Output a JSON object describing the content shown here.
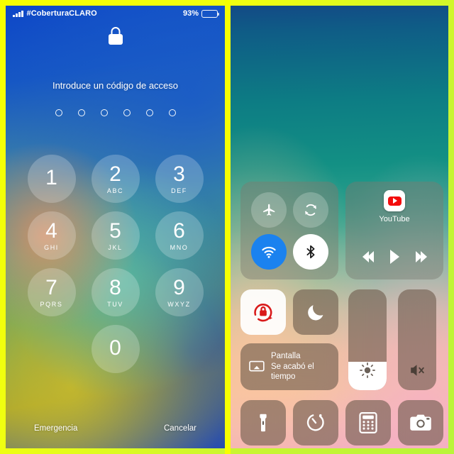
{
  "theme": {
    "border_color": "#f2ff1a",
    "divider_color": "#f7ff00",
    "accent_blue": "#1b82ef",
    "accent_red": "#d91a1a",
    "battery_green": "#35e06a"
  },
  "lock_screen": {
    "status_bar": {
      "signal_icon": "signal-bars-icon",
      "carrier": "#CoberturaCLARO",
      "battery_percent": "93%",
      "battery_level": 93,
      "battery_icon": "battery-icon"
    },
    "lock_icon": "lock-closed-icon",
    "prompt": "Introduce un código de acceso",
    "passcode": {
      "length": 6,
      "filled": 0
    },
    "keypad": [
      {
        "digit": "1",
        "letters": ""
      },
      {
        "digit": "2",
        "letters": "ABC"
      },
      {
        "digit": "3",
        "letters": "DEF"
      },
      {
        "digit": "4",
        "letters": "GHI"
      },
      {
        "digit": "5",
        "letters": "JKL"
      },
      {
        "digit": "6",
        "letters": "MNO"
      },
      {
        "digit": "7",
        "letters": "PQRS"
      },
      {
        "digit": "8",
        "letters": "TUV"
      },
      {
        "digit": "9",
        "letters": "WXYZ"
      },
      {
        "digit": "0",
        "letters": ""
      }
    ],
    "footer": {
      "emergency": "Emergencia",
      "cancel": "Cancelar"
    }
  },
  "control_center": {
    "connectivity": {
      "airplane": {
        "icon": "airplane-icon",
        "state": "off"
      },
      "cellular": {
        "icon": "cellular-data-icon",
        "state": "off"
      },
      "wifi": {
        "icon": "wifi-icon",
        "state": "on"
      },
      "bluetooth": {
        "icon": "bluetooth-icon",
        "state": "on"
      }
    },
    "media": {
      "app_icon": "youtube-icon",
      "app_label": "YouTube",
      "rewind_icon": "rewind-icon",
      "play_icon": "play-icon",
      "forward_icon": "fast-forward-icon"
    },
    "rotation_lock": {
      "icon": "rotation-lock-icon",
      "state": "on"
    },
    "do_not_disturb": {
      "icon": "moon-icon",
      "state": "off"
    },
    "screen_mirroring": {
      "icon": "airplay-screen-icon",
      "line1": "Pantalla",
      "line2": "Se acabó el tiempo"
    },
    "brightness": {
      "icon": "brightness-icon",
      "value": 28
    },
    "volume": {
      "icon": "volume-mute-icon",
      "value": 0
    },
    "apps": [
      {
        "icon": "flashlight-icon",
        "name": "flashlight"
      },
      {
        "icon": "timer-icon",
        "name": "timer"
      },
      {
        "icon": "calculator-icon",
        "name": "calculator"
      },
      {
        "icon": "camera-icon",
        "name": "camera"
      }
    ]
  }
}
